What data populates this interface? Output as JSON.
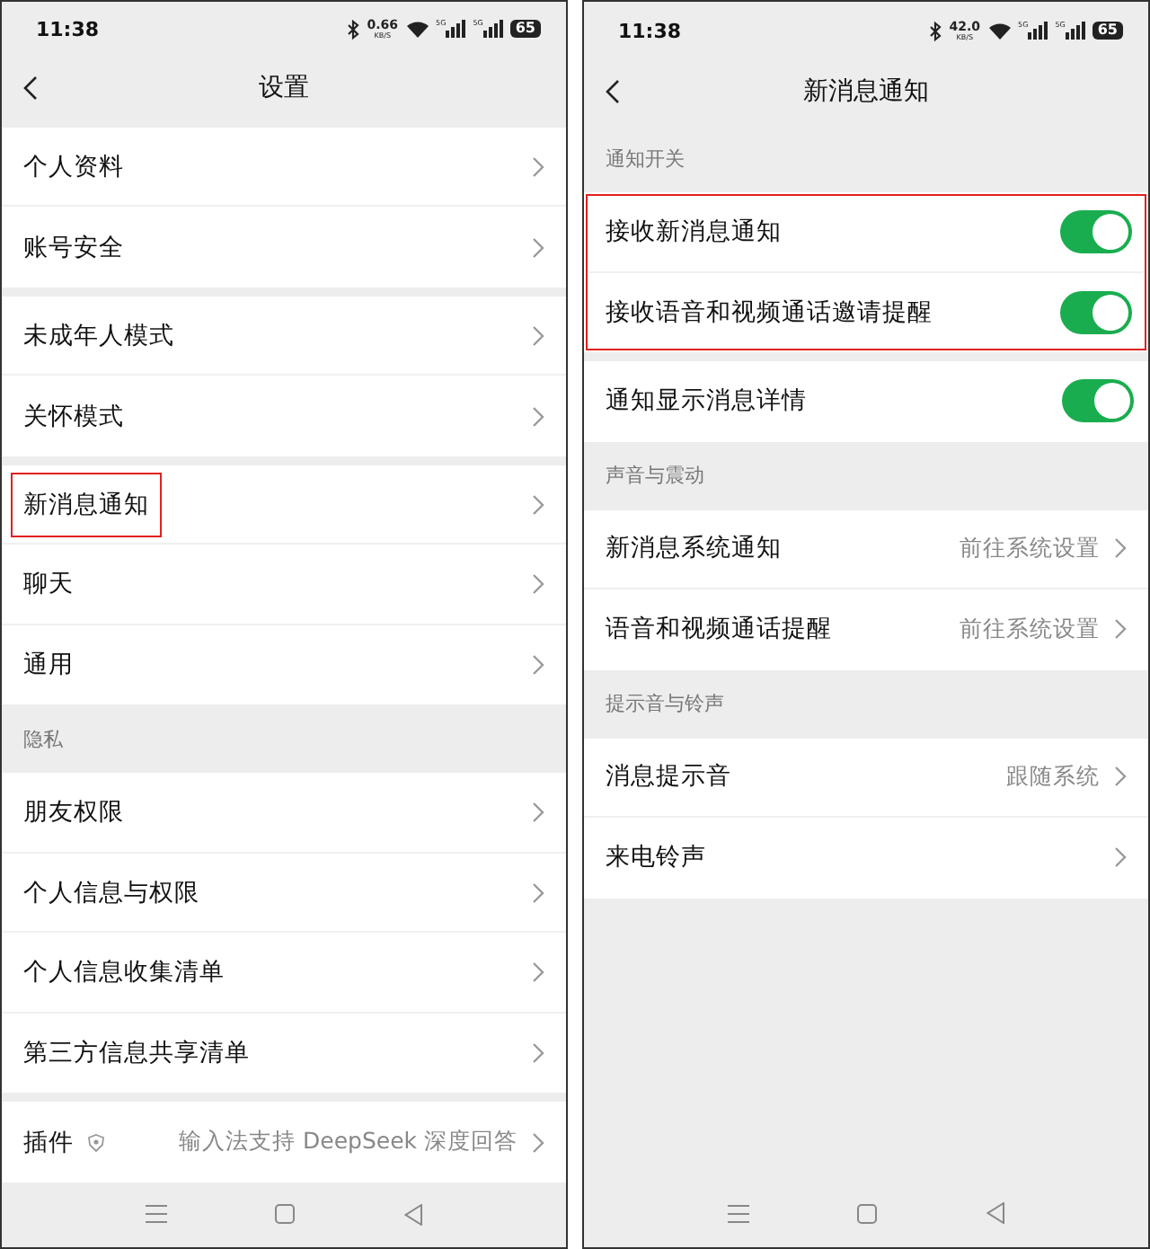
{
  "panels": [
    {
      "status": {
        "time": "11:38",
        "speed": "0.66",
        "speed_unit": "KB/S",
        "networks": [
          "5G",
          "5G"
        ],
        "battery": "65"
      },
      "title": "设置",
      "sections": [
        {
          "highlighted": false,
          "rows": [
            {
              "kind": "link",
              "label": "个人资料",
              "highlighted": false
            },
            {
              "kind": "link",
              "label": "账号安全",
              "highlighted": false
            }
          ]
        },
        {
          "highlighted": false,
          "rows": [
            {
              "kind": "link",
              "label": "未成年人模式",
              "highlighted": false
            },
            {
              "kind": "link",
              "label": "关怀模式",
              "highlighted": false
            }
          ]
        },
        {
          "highlighted": false,
          "rows": [
            {
              "kind": "link",
              "label": "新消息通知",
              "highlighted": true
            },
            {
              "kind": "link",
              "label": "聊天",
              "highlighted": false
            },
            {
              "kind": "link",
              "label": "通用",
              "highlighted": false
            }
          ]
        },
        {
          "header": "隐私",
          "highlighted": false,
          "rows": [
            {
              "kind": "link",
              "label": "朋友权限",
              "highlighted": false
            },
            {
              "kind": "link",
              "label": "个人信息与权限",
              "highlighted": false
            },
            {
              "kind": "link",
              "label": "个人信息收集清单",
              "highlighted": false
            },
            {
              "kind": "link",
              "label": "第三方信息共享清单",
              "highlighted": false
            }
          ]
        },
        {
          "highlighted": false,
          "rows": [
            {
              "kind": "plugin",
              "label": "插件",
              "value": "输入法支持 DeepSeek 深度回答",
              "highlighted": false
            }
          ]
        }
      ]
    },
    {
      "status": {
        "time": "11:38",
        "speed": "42.0",
        "speed_unit": "KB/S",
        "networks": [
          "5G",
          "5G"
        ],
        "battery": "65"
      },
      "title": "新消息通知",
      "sections": [
        {
          "header": "通知开关",
          "highlighted": true,
          "rows": [
            {
              "kind": "toggle",
              "label": "接收新消息通知",
              "on": true,
              "highlighted": false
            },
            {
              "kind": "toggle",
              "label": "接收语音和视频通话邀请提醒",
              "on": true,
              "highlighted": false
            }
          ]
        },
        {
          "highlighted": false,
          "rows": [
            {
              "kind": "toggle",
              "label": "通知显示消息详情",
              "on": true,
              "highlighted": false
            }
          ]
        },
        {
          "header": "声音与震动",
          "highlighted": false,
          "rows": [
            {
              "kind": "link",
              "label": "新消息系统通知",
              "value": "前往系统设置",
              "highlighted": false
            },
            {
              "kind": "link",
              "label": "语音和视频通话提醒",
              "value": "前往系统设置",
              "highlighted": false
            }
          ]
        },
        {
          "header": "提示音与铃声",
          "highlighted": false,
          "rows": [
            {
              "kind": "link",
              "label": "消息提示音",
              "value": "跟随系统",
              "highlighted": false
            },
            {
              "kind": "link",
              "label": "来电铃声",
              "highlighted": false
            }
          ]
        }
      ]
    }
  ]
}
